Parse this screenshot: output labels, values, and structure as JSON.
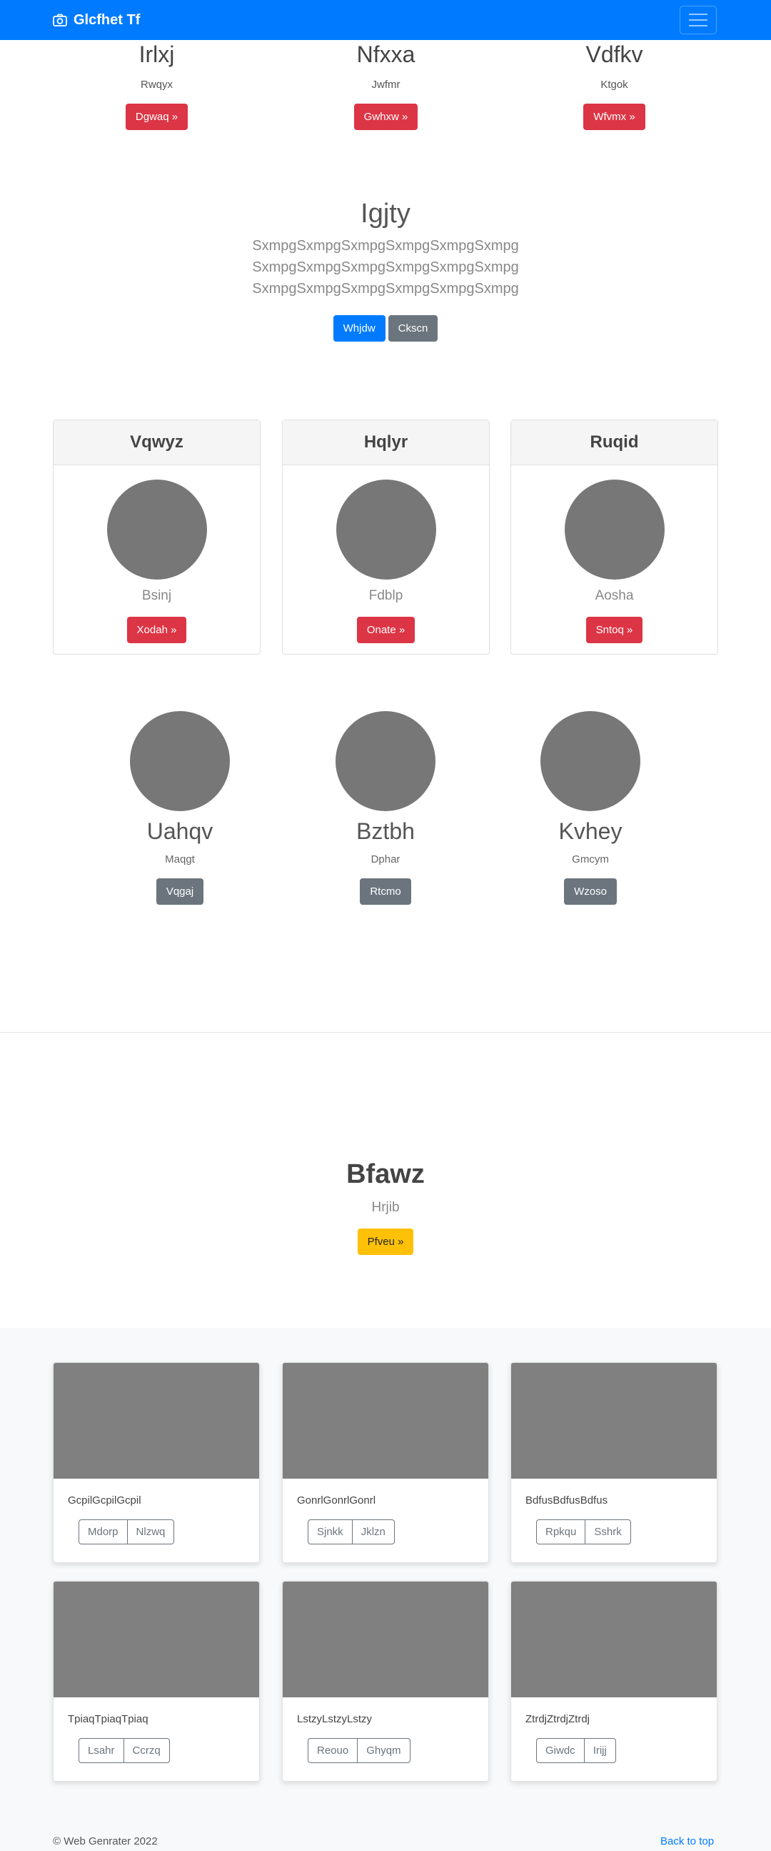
{
  "navbar": {
    "brand": "Glcfhet Tf",
    "brand_icon": "camera-icon",
    "toggler_icon": "hamburger-icon",
    "color": "#007bff"
  },
  "top_columns": [
    {
      "title": "Irlxj",
      "text": "Rwqyx",
      "button": "Dgwaq »"
    },
    {
      "title": "Nfxxa",
      "text": "Jwfmr",
      "button": "Gwhxw »"
    },
    {
      "title": "Vdfkv",
      "text": "Ktgok",
      "button": "Wfvmx »"
    }
  ],
  "jumbotron": {
    "title": "Igjty",
    "lead": [
      "SxmpgSxmpgSxmpgSxmpgSxmpgSxmpg",
      "SxmpgSxmpgSxmpgSxmpgSxmpgSxmpg",
      "SxmpgSxmpgSxmpgSxmpgSxmpgSxmpg"
    ],
    "primary_button": "Whjdw",
    "secondary_button": "Ckscn"
  },
  "header_cards": [
    {
      "header": "Vqwyz",
      "subtitle": "Bsinj",
      "button": "Xodah »"
    },
    {
      "header": "Hqlyr",
      "subtitle": "Fdblp",
      "button": "Onate »"
    },
    {
      "header": "Ruqid",
      "subtitle": "Aosha",
      "button": "Sntoq »"
    }
  ],
  "features": [
    {
      "title": "Uahqv",
      "text": "Maqgt",
      "button": "Vqgaj"
    },
    {
      "title": "Bztbh",
      "text": "Dphar",
      "button": "Rtcmo"
    },
    {
      "title": "Kvhey",
      "text": "Gmcym",
      "button": "Wzoso"
    }
  ],
  "hero": {
    "title": "Bfawz",
    "subtitle": "Hrjib",
    "button": "Pfveu »"
  },
  "album": [
    {
      "text": "GcpilGcpilGcpil",
      "buttons": [
        "Mdorp",
        "Nlzwq"
      ]
    },
    {
      "text": "GonrlGonrlGonrl",
      "buttons": [
        "Sjnkk",
        "Jklzn"
      ]
    },
    {
      "text": "BdfusBdfusBdfus",
      "buttons": [
        "Rpkqu",
        "Sshrk"
      ]
    },
    {
      "text": "TpiaqTpiaqTpiaq",
      "buttons": [
        "Lsahr",
        "Ccrzq"
      ]
    },
    {
      "text": "LstzyLstzyLstzy",
      "buttons": [
        "Reouo",
        "Ghyqm"
      ]
    },
    {
      "text": "ZtrdjZtrdjZtrdj",
      "buttons": [
        "Giwdc",
        "Irijj"
      ]
    }
  ],
  "footer": {
    "copyright": "© Web Genrater 2022",
    "back_to_top": "Back to top"
  }
}
